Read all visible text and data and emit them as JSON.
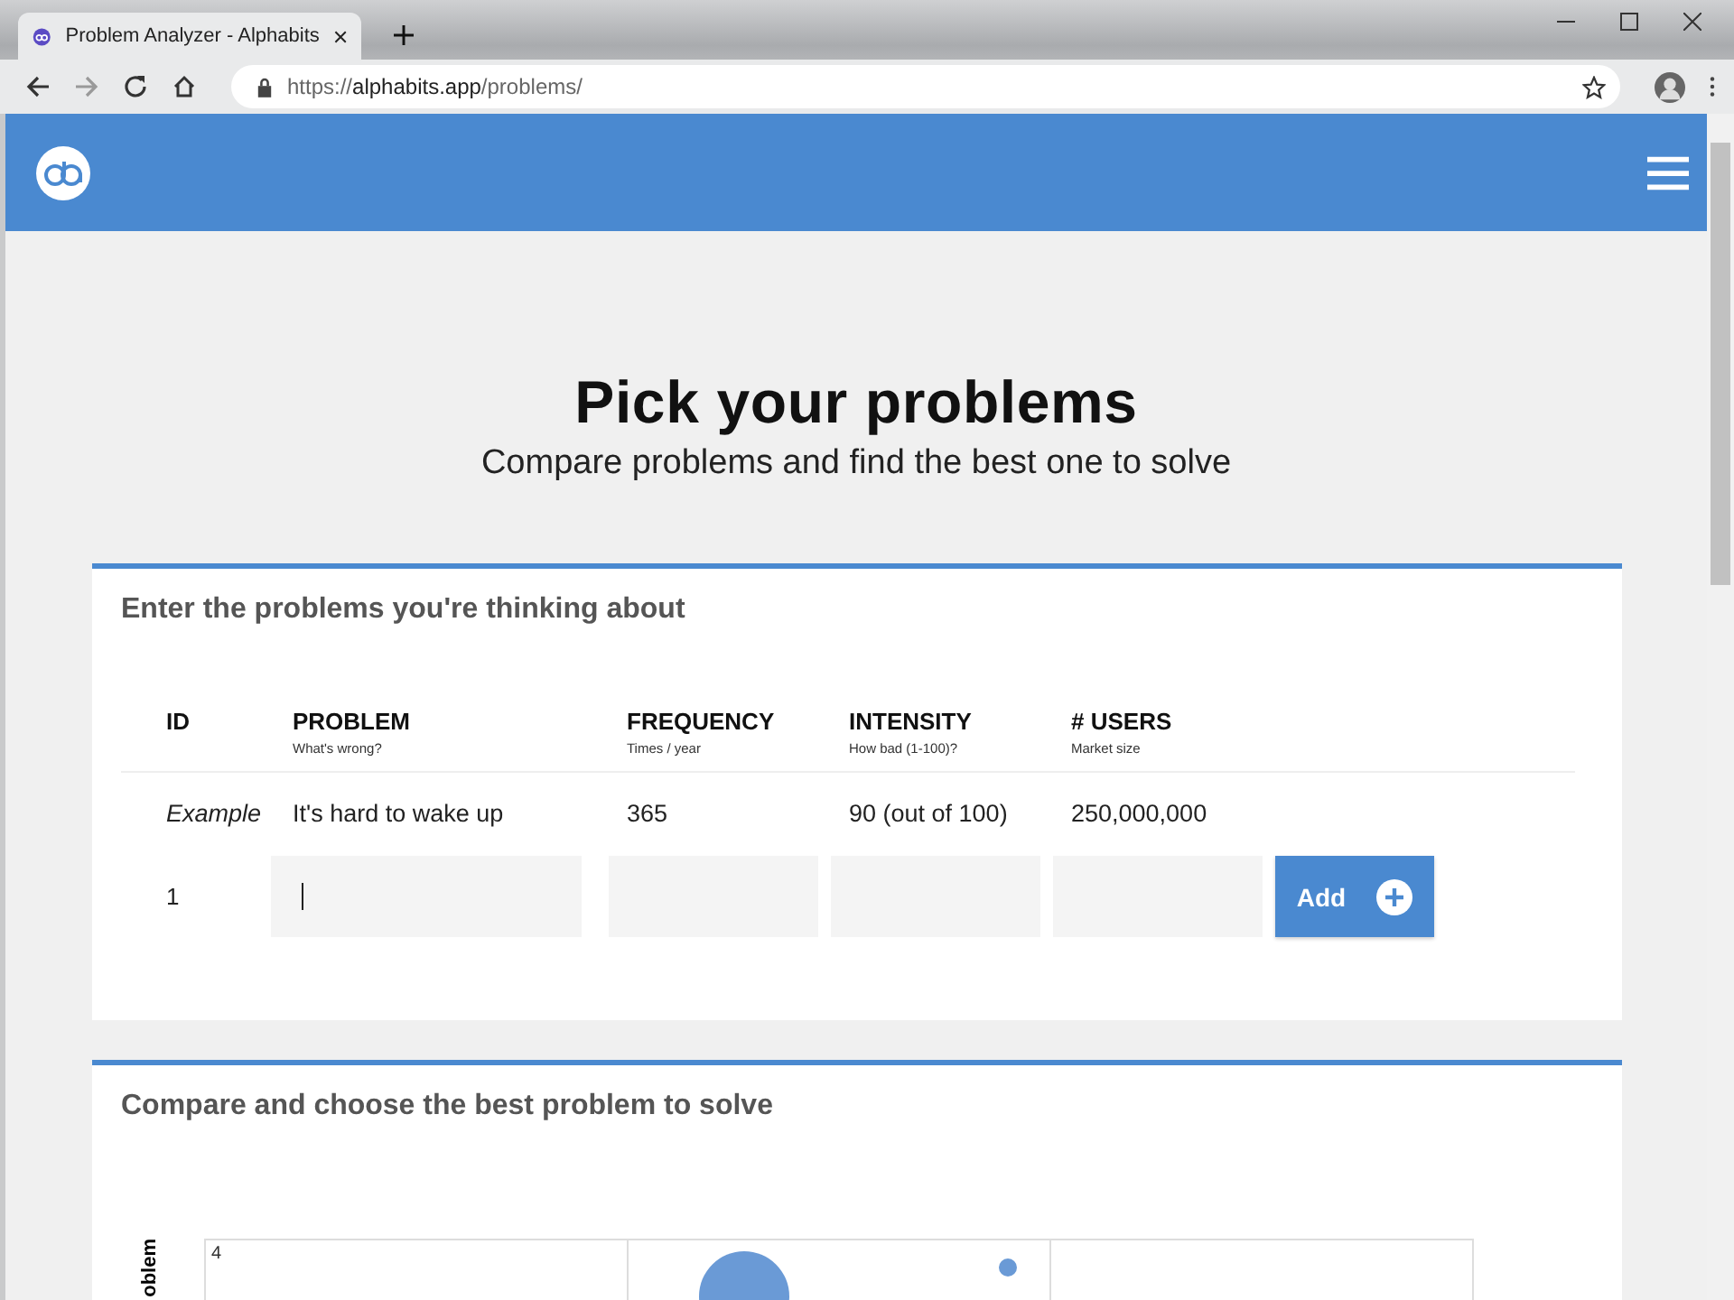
{
  "browser": {
    "tab_title": "Problem Analyzer - Alphabits",
    "url": {
      "scheme": "https://",
      "host": "alphabits.app",
      "path": "/problems/"
    }
  },
  "hero": {
    "title": "Pick your problems",
    "subtitle": "Compare problems and find the best one to solve"
  },
  "entry": {
    "title": "Enter the problems you're thinking about",
    "columns": [
      {
        "label": "ID"
      },
      {
        "label": "PROBLEM",
        "hint": "What's wrong?"
      },
      {
        "label": "FREQUENCY",
        "hint": "Times / year"
      },
      {
        "label": "INTENSITY",
        "hint": "How bad (1-100)?"
      },
      {
        "label": "# USERS",
        "hint": "Market size"
      }
    ],
    "example": {
      "id": "Example",
      "cells": [
        "It's hard to wake up",
        "365",
        "90 (out of 100)",
        "250,000,000"
      ]
    },
    "new_row": {
      "id": "1"
    },
    "add_button": "Add"
  },
  "compare": {
    "title": "Compare and choose the best problem to solve",
    "chart": {
      "y_axis_label": "oblem",
      "y_tick": "4"
    }
  }
}
